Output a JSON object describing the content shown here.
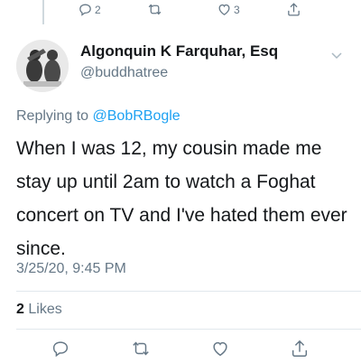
{
  "top_actions": {
    "reply_count": "2",
    "like_count": "3"
  },
  "tweet": {
    "display_name": "Algonquin K Farquhar, Esq",
    "handle": "@buddhatree",
    "replying_prefix": "Replying to",
    "replying_to": "@BobRBogle",
    "text": "When I was 12, my cousin made me stay up until 2am to watch a Foghat concert on TV and I've hated them ever since.",
    "timestamp": "3/25/20, 9:45 PM"
  },
  "stats": {
    "likes_count": "2",
    "likes_label": "Likes"
  },
  "icons": {
    "reply": "reply-icon",
    "retweet": "retweet-icon",
    "like": "heart-icon",
    "share": "share-icon",
    "more": "chevron-down-icon"
  },
  "colors": {
    "link": "#1da1f2",
    "secondary_text": "#657786",
    "primary_text": "#14171a"
  }
}
